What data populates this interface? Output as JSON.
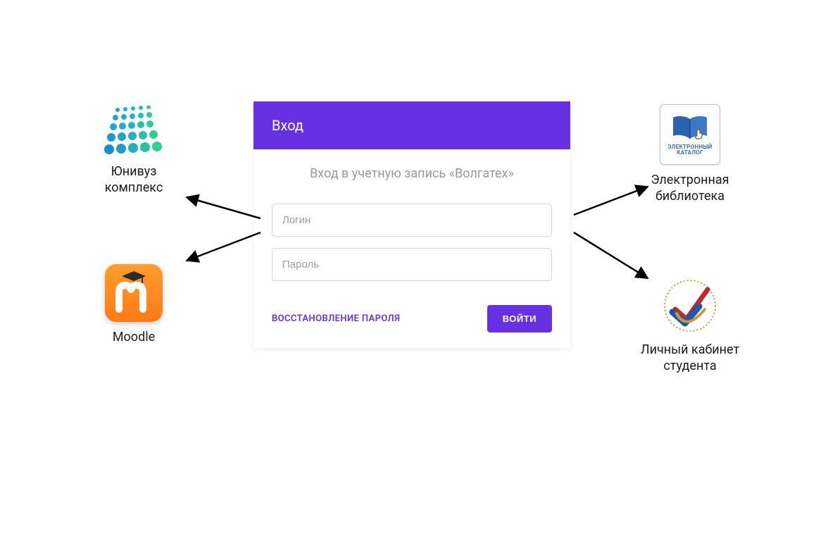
{
  "login": {
    "header": "Вход",
    "subtitle": "Вход в учетную запись «Волгатех»",
    "fields": {
      "login_placeholder": "Логин",
      "password_placeholder": "Пароль"
    },
    "recover_label": "ВОССТАНОВЛЕНИЕ ПАРОЛЯ",
    "submit_label": "ВОЙТИ"
  },
  "destinations": {
    "univuz": {
      "label": "Юнивуз\nкомплекс"
    },
    "moodle": {
      "label": "Moodle"
    },
    "elib": {
      "label": "Электронная\nбиблиотека",
      "tile_caption": "ЭЛЕКТРОННЫЙ\nКАТАЛОГ"
    },
    "cabinet": {
      "label": "Личный кабинет\nстудента"
    }
  }
}
